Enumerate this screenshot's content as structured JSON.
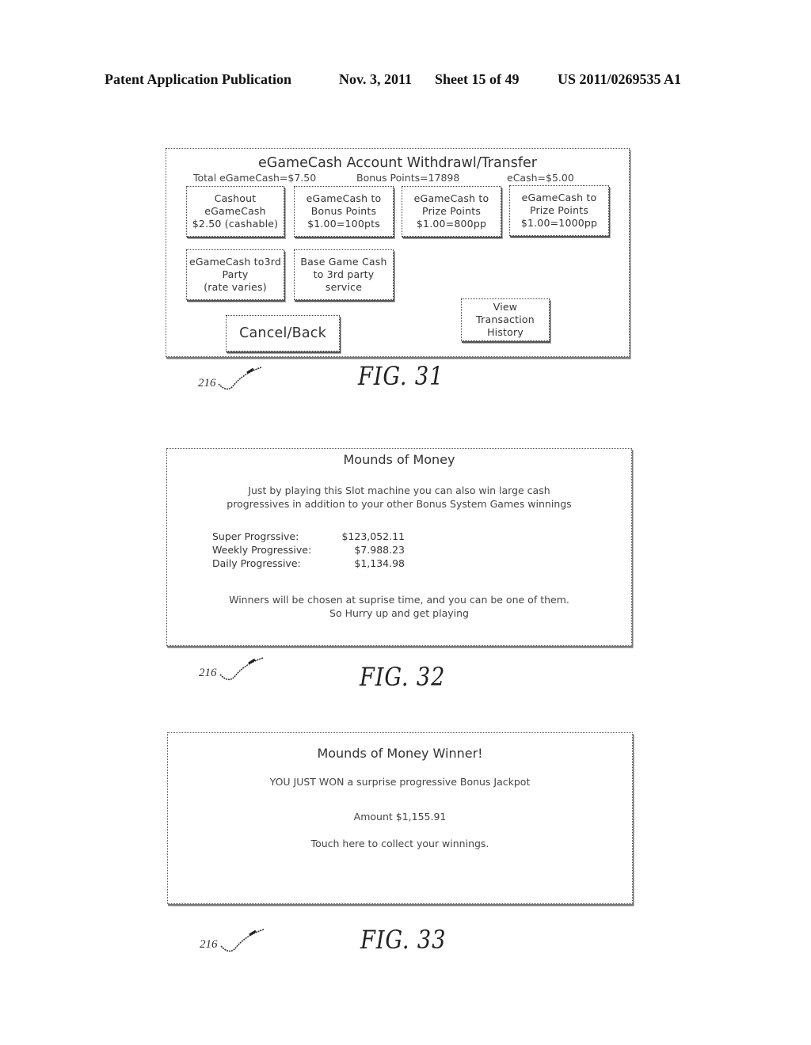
{
  "header": {
    "publication": "Patent Application Publication",
    "date": "Nov. 3, 2011",
    "sheet": "Sheet 15 of 49",
    "number": "US 2011/0269535 A1"
  },
  "fig31": {
    "title": "eGameCash Account Withdrawl/Transfer",
    "total": "Total eGameCash=$7.50",
    "bonus_points": "Bonus Points=17898",
    "ecash": "eCash=$5.00",
    "buttons": [
      {
        "lines": [
          "Cashout",
          "eGameCash",
          "$2.50 (cashable)"
        ]
      },
      {
        "lines": [
          "eGameCash to",
          "Bonus Points",
          "$1.00=100pts"
        ]
      },
      {
        "lines": [
          "eGameCash to",
          "Prize Points",
          "$1.00=800pp"
        ]
      },
      {
        "lines": [
          "eGameCash to",
          "Prize Points",
          "$1.00=1000pp"
        ]
      },
      {
        "lines": [
          "eGameCash to3rd",
          "Party",
          "(rate varies)"
        ]
      },
      {
        "lines": [
          "Base Game Cash",
          "to 3rd party",
          "service"
        ]
      }
    ],
    "cancel_label": "Cancel/Back",
    "history": {
      "lines": [
        "View",
        "Transaction",
        "History"
      ]
    },
    "ref": "216",
    "label": "FIG. 31"
  },
  "fig32": {
    "title": "Mounds of Money",
    "intro": [
      "Just by playing this Slot machine you can also win large cash",
      "progressives in addition to your other Bonus System Games winnings"
    ],
    "progressives": [
      {
        "label": "Super Progrssive:",
        "value": "$123,052.11"
      },
      {
        "label": "Weekly Progressive:",
        "value": "$7.988.23"
      },
      {
        "label": "Daily Progressive:",
        "value": "$1,134.98"
      }
    ],
    "outro": [
      "Winners will be chosen at suprise time, and you can be one of them.",
      "So Hurry up and get playing"
    ],
    "ref": "216",
    "label": "FIG. 32"
  },
  "fig33": {
    "title": "Mounds of Money Winner!",
    "message": "YOU JUST WON a surprise progressive Bonus Jackpot",
    "amount": "Amount $1,155.91",
    "collect": "Touch here to collect your winnings.",
    "ref": "216",
    "label": "FIG. 33"
  }
}
